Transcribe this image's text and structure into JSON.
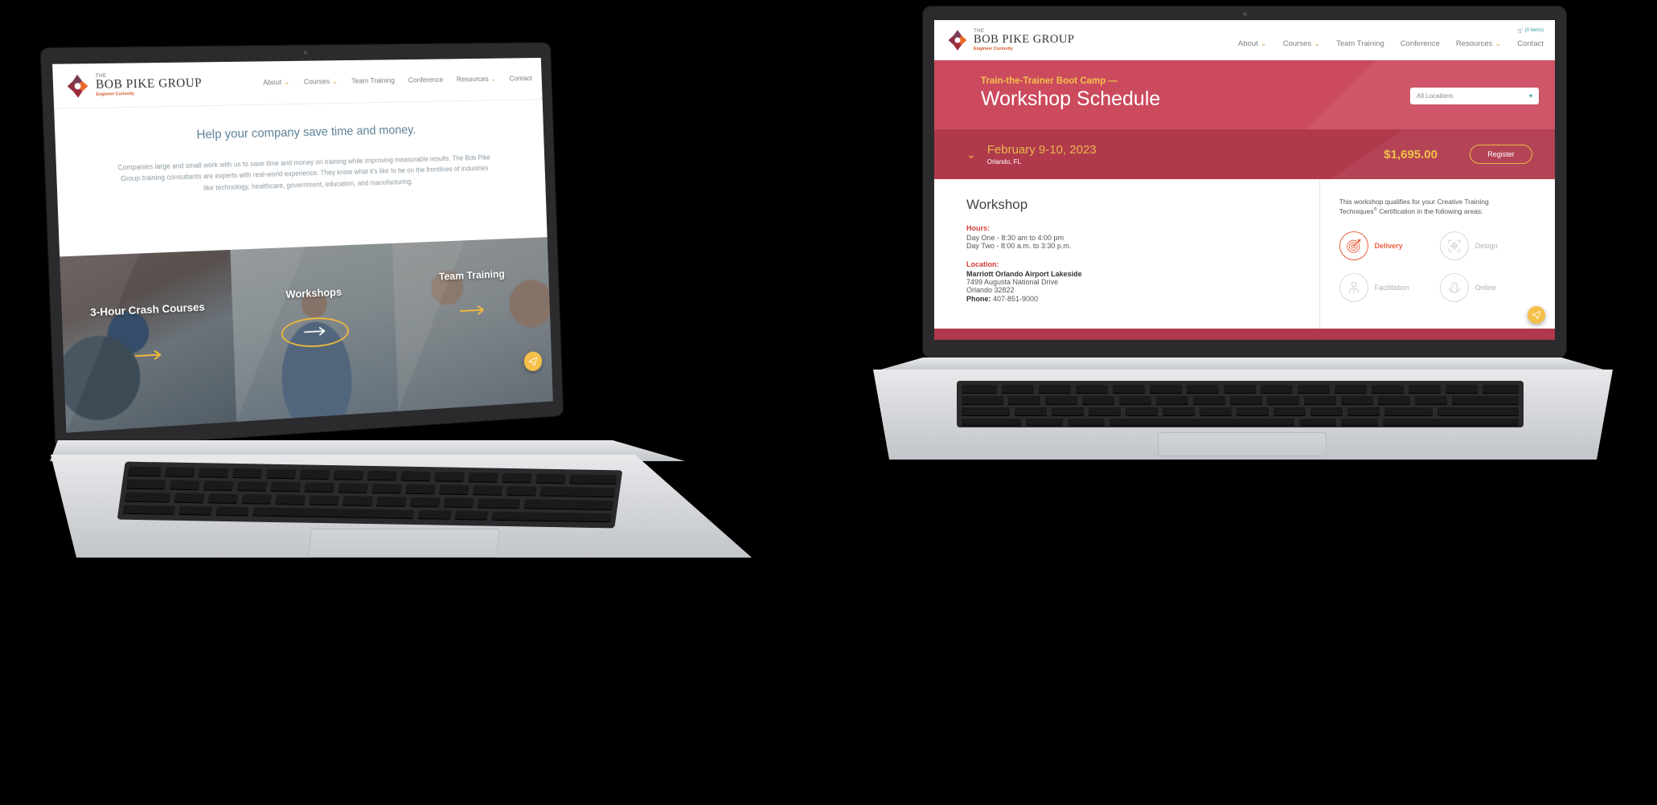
{
  "brand": {
    "the": "THE",
    "name": "BOB PIKE GROUP",
    "tagline": "Engineer Curiosity"
  },
  "nav": {
    "items": [
      {
        "label": "About",
        "caret": true
      },
      {
        "label": "Courses",
        "caret": true
      },
      {
        "label": "Team Training",
        "caret": false
      },
      {
        "label": "Conference",
        "caret": false
      },
      {
        "label": "Resources",
        "caret": true
      },
      {
        "label": "Contact",
        "caret": false
      }
    ],
    "cart": "(0 items)",
    "cart_icon": "shopping-cart-icon"
  },
  "left_laptop": {
    "page": {
      "heading": "Help your company save time and money.",
      "paragraph": "Companies large and small work with us to save time and money on training while improving measurable results. The Bob Pike Group training consultants are experts with real-world experience. They know what it's like to be on the frontlines of industries like technology, healthcare, government, education, and manufacturing.",
      "cards": [
        {
          "label": "3-Hour Crash Courses",
          "highlighted": false
        },
        {
          "label": "Workshops",
          "highlighted": true
        },
        {
          "label": "Team Training",
          "highlighted": false
        }
      ],
      "fab_icon": "paper-plane-icon"
    }
  },
  "right_laptop": {
    "hero": {
      "eyebrow": "Train-the-Trainer Boot Camp —",
      "title": "Workshop Schedule",
      "location_filter": {
        "value": "All Locations",
        "icon": "chevron-down-icon"
      }
    },
    "date_row": {
      "expand_icon": "chevron-down-icon",
      "date": "February 9-10, 2023",
      "city": "Orlando, FL",
      "price": "$1,695.00",
      "register_label": "Register"
    },
    "workshop": {
      "title": "Workshop",
      "hours_label": "Hours:",
      "hours": [
        "Day One - 8:30 am to 4:00 pm",
        "Day Two - 8:00 a.m. to 3:30 p.m."
      ],
      "location_label": "Location:",
      "venue": "Marriott Orlando Airport Lakeside",
      "street": "7499 Augusta National Drive",
      "city_zip": "Orlando 32822",
      "phone_label": "Phone:",
      "phone": "407-851-9000"
    },
    "certification": {
      "intro_line1": "This workshop qualifies for your Creative Training",
      "intro_line2_a": "Techniques",
      "intro_line2_sup": "®",
      "intro_line2_b": " Certification in the following areas:",
      "areas": [
        {
          "label": "Delivery",
          "icon": "target-icon",
          "active": true
        },
        {
          "label": "Design",
          "icon": "focus-frame-icon",
          "active": false
        },
        {
          "label": "Facilitation",
          "icon": "person-icon",
          "active": false
        },
        {
          "label": "Online",
          "icon": "mouse-icon",
          "active": false
        }
      ]
    },
    "fab_icon": "paper-plane-icon"
  },
  "colors": {
    "hero_red": "#cc4a5d",
    "date_red": "#b03a4c",
    "gold": "#e8b84b",
    "accent_orange": "#e8603c",
    "teal": "#2d9aa8",
    "heading_blue": "#5b7f96"
  }
}
